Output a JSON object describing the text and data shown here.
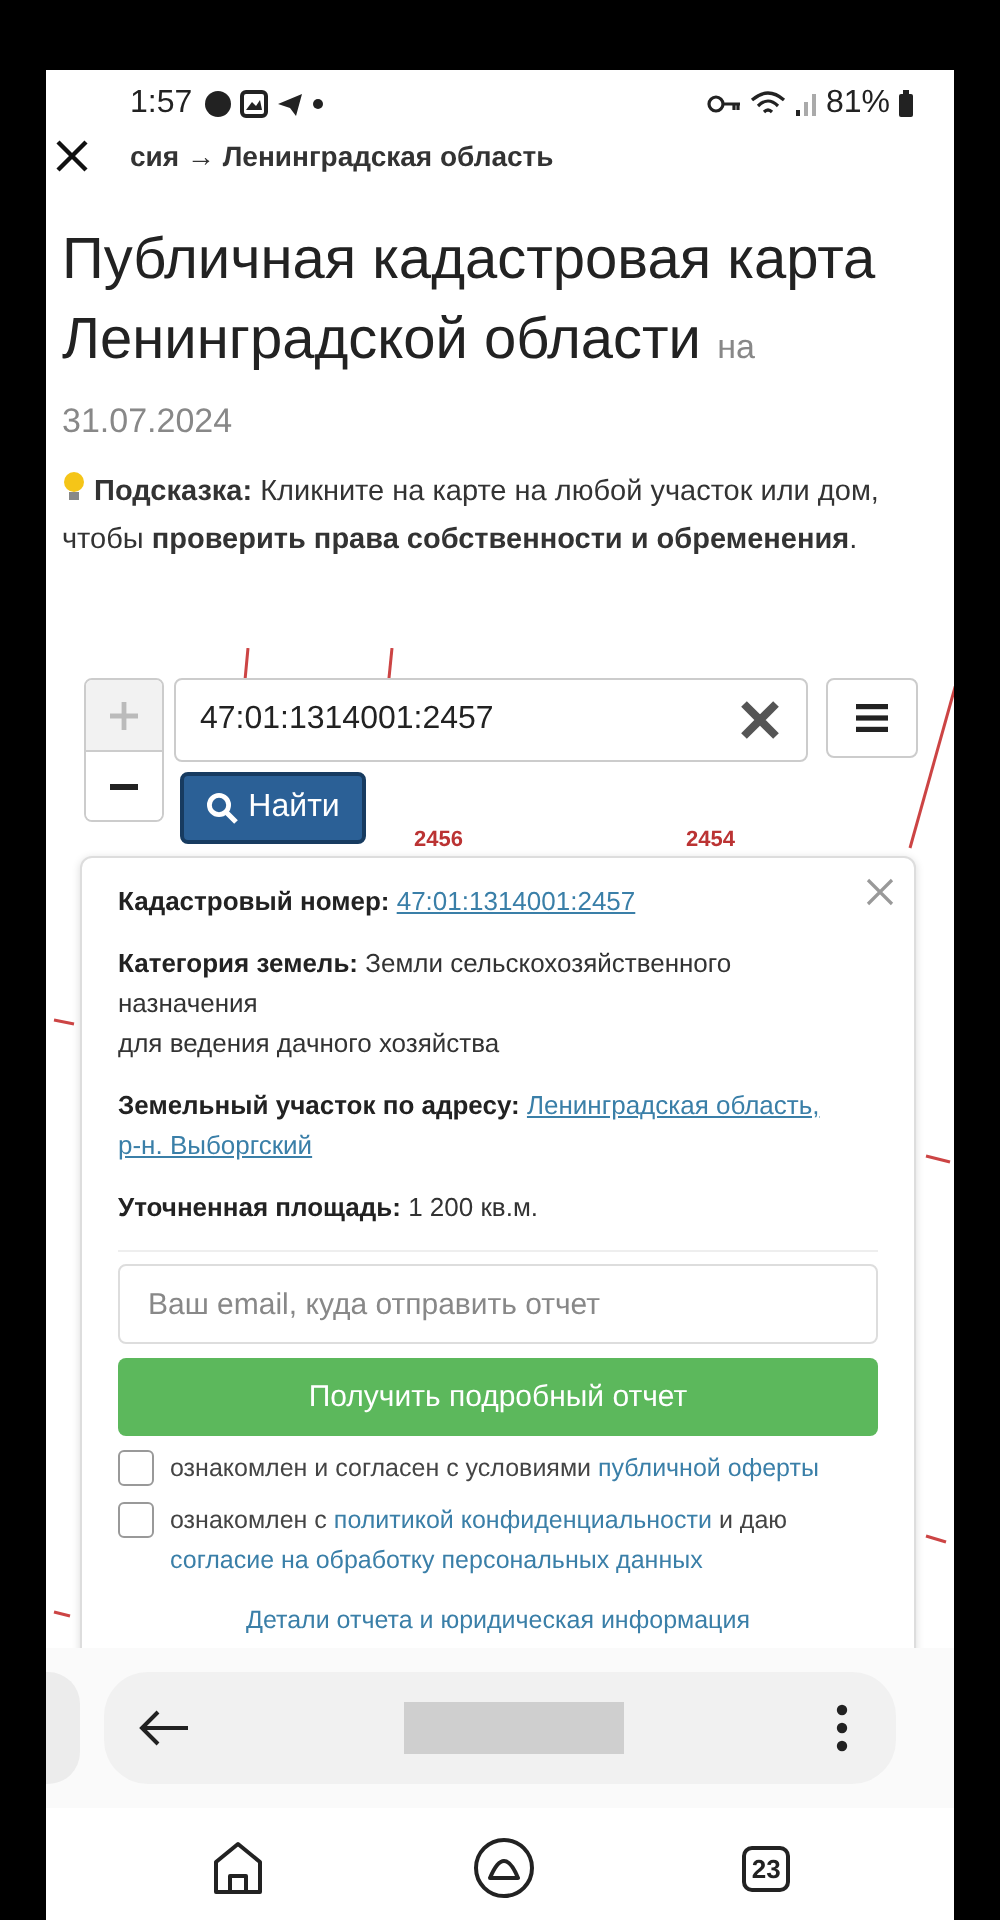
{
  "status_bar": {
    "time": "1:57",
    "battery": "81%"
  },
  "breadcrumb": "сия → Ленинградская область",
  "title": "Публичная кадастровая карта Ленинградской области",
  "title_suffix": "на",
  "date": "31.07.2024",
  "hint": "**Подсказка:** Кликните на карте на любой участок или дом, чтобы **проверить права собственности и обременения**.",
  "map": {
    "parcel_labels": [
      "2456",
      "2454"
    ],
    "zoom_in_disabled": true,
    "search": {
      "value": "47:01:1314001:2457"
    },
    "find_button": "Найти"
  },
  "popup": {
    "fields": [
      {
        "label": "Кадастровый номер:",
        "kind": "link",
        "links": [
          "47:01:1314001:2457"
        ]
      },
      {
        "label": "Категория земель:",
        "kind": "text",
        "value": "Земли сельскохозяйственного назначения",
        "note": "для ведения дачного хозяйства"
      },
      {
        "label": "Земельный участок по адресу:",
        "kind": "link",
        "links": [
          "Ленинградская область,",
          "р-н. Выборгский"
        ]
      },
      {
        "label": "Уточненная площадь:",
        "kind": "text",
        "value": "1 200 кв.м."
      }
    ],
    "email": {
      "placeholder": "Ваш email, куда отправить отчет"
    },
    "submit": "Получить подробный отчет",
    "agreements": [
      {
        "checked": false,
        "parts": [
          {
            "kind": "text",
            "text": "ознакомлен и согласен с условиями"
          },
          {
            "kind": "link",
            "text": "публичной оферты"
          }
        ]
      },
      {
        "checked": false,
        "parts": [
          {
            "kind": "text",
            "text": "ознакомлен с"
          },
          {
            "kind": "link",
            "text": "политикой конфиденциальности"
          },
          {
            "kind": "text",
            "text": "и даю"
          },
          {
            "kind": "link",
            "text": "согласие на обработку персональных данных"
          }
        ]
      }
    ],
    "details_link": "Детали отчета и юридическая информация"
  },
  "nav": {
    "tab_count": "23"
  }
}
